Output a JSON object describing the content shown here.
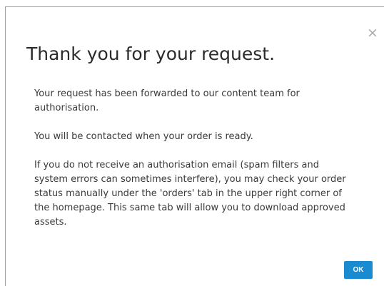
{
  "dialog": {
    "close_icon": "close-icon",
    "close_glyph": "×",
    "title": "Thank you for your request.",
    "paragraphs": [
      "Your request has been forwarded to our content team for authorisation.",
      "You will be contacted when your order is ready.",
      "If you do not receive an authorisation email (spam filters and system errors can sometimes interfere), you may check your order status manually under the 'orders' tab in the upper right corner of the homepage. This same tab will allow you to download approved assets."
    ],
    "ok_label": "OK"
  },
  "colors": {
    "accent": "#1a8bd0",
    "dialog_border": "#7fa9c9",
    "close_icon": "#a9a9a9",
    "title_text": "#2b2b2b",
    "body_text": "#3a3a3a"
  }
}
